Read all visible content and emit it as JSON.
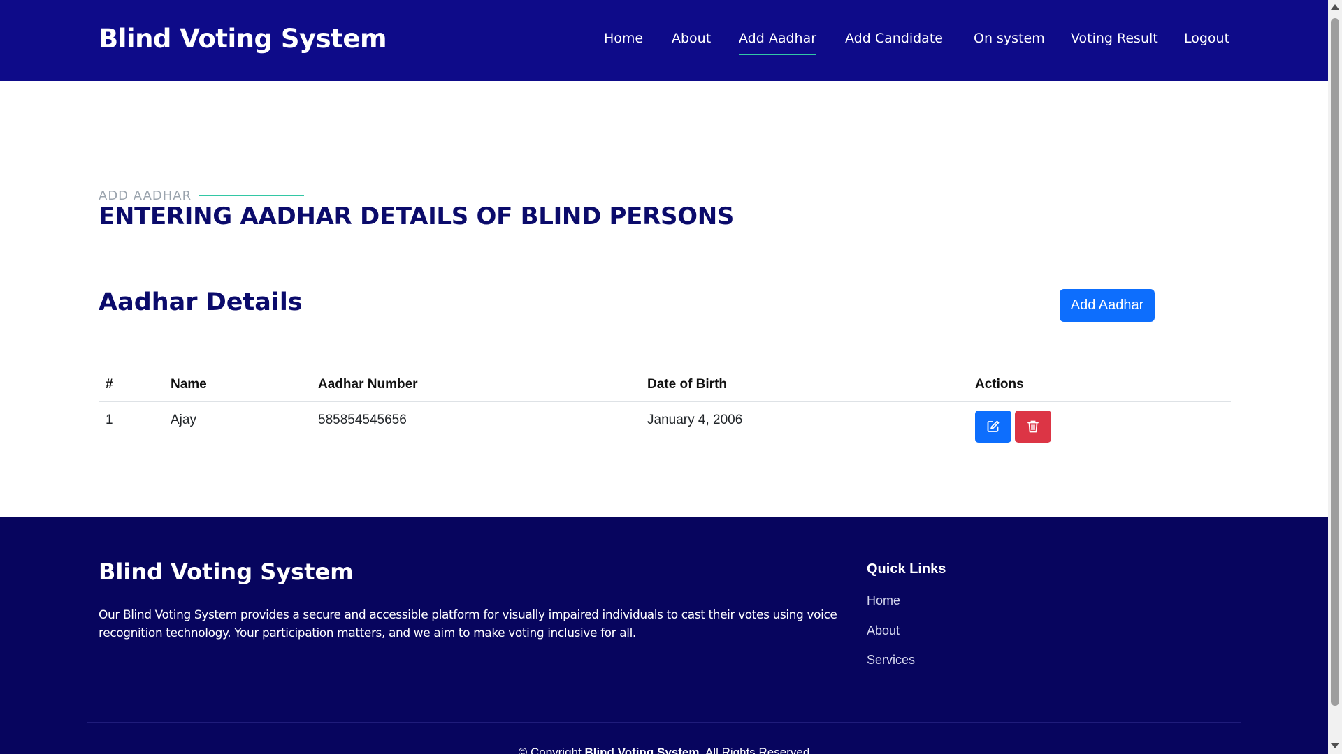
{
  "header": {
    "brand": "Blind Voting System",
    "nav": [
      {
        "label": "Home"
      },
      {
        "label": "About"
      },
      {
        "label": "Add Aadhar",
        "active": true
      },
      {
        "label": "Add Candidate"
      },
      {
        "label": "On system"
      },
      {
        "label": "Voting Result"
      },
      {
        "label": "Logout"
      }
    ]
  },
  "section": {
    "subtitle": "ADD AADHAR",
    "title": "ENTERING AADHAR DETAILS OF BLIND PERSONS"
  },
  "details": {
    "title": "Aadhar Details",
    "add_button": "Add Aadhar"
  },
  "table": {
    "columns": [
      "#",
      "Name",
      "Aadhar Number",
      "Date of Birth",
      "Actions"
    ],
    "rows": [
      {
        "index": "1",
        "name": "Ajay",
        "aadhar": "585854545656",
        "dob": "January 4, 2006"
      }
    ],
    "edit_icon": "edit-icon",
    "delete_icon": "trash-icon"
  },
  "footer": {
    "brand": "Blind Voting System",
    "description": "Our Blind Voting System provides a secure and accessible platform for visually impaired individuals to cast their votes using voice recognition technology. Your participation matters, and we aim to make voting inclusive for all.",
    "quick_links_title": "Quick Links",
    "links": [
      "Home",
      "About",
      "Services"
    ],
    "copyright_prefix": "© Copyright",
    "copyright_brand": "Blind Voting System",
    "copyright_suffix": ". All Rights Reserved"
  },
  "colors": {
    "header_bg": "#0e0b89",
    "footer_bg": "#07055e",
    "accent": "#33c7a5",
    "primary": "#0d6efd",
    "danger": "#dc3545"
  }
}
